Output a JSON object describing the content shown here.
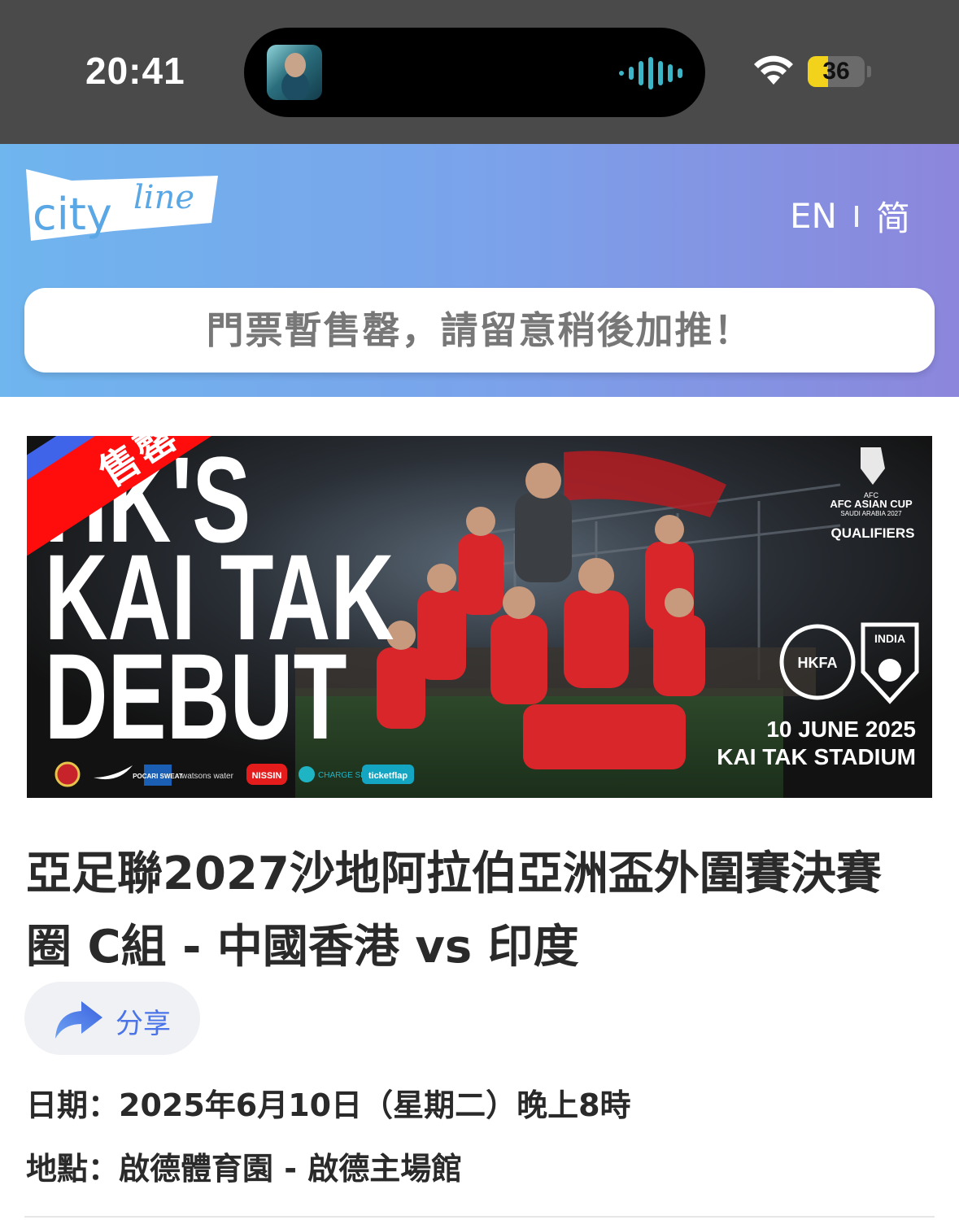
{
  "status_bar": {
    "time": "20:41",
    "battery_percent": "36",
    "battery_level": 0.36,
    "icons": [
      "now-playing-artwork",
      "audio-waveform-icon",
      "wifi-icon",
      "battery-icon"
    ]
  },
  "header": {
    "logo_text": "cityline",
    "lang_en": "EN",
    "lang_sc": "简",
    "notice": "門票暫售罄，請留意稍後加推！"
  },
  "banner": {
    "sold_out_label": "售罄",
    "headline_line1": "HK'S",
    "headline_line2": "KAI TAK",
    "headline_line3": "DEBUT",
    "competition": "AFC ASIAN CUP",
    "competition_sub": "SAUDI ARABIA 2027",
    "stage": "QUALIFIERS",
    "team_home_badge": "HKFA",
    "team_away_badge": "INDIA",
    "match_date": "10 JUNE 2025",
    "match_venue": "KAI TAK STADIUM",
    "sponsors": [
      "POCARI SWEAT",
      "watsons water",
      "NISSIN",
      "CHARGE SPOT",
      "ticketflap"
    ]
  },
  "event": {
    "title": "亞足聯2027沙地阿拉伯亞洲盃外圍賽決賽圈 C組 - 中國香港 vs 印度",
    "share_label": "分享",
    "date_line": "日期：2025年6月10日（星期二）晚上8時",
    "venue_line": "地點：啟德體育園 - 啟德主場館"
  },
  "colors": {
    "status_bar_bg": "#4a4a4a",
    "header_gradient_start": "#6fb5ee",
    "header_gradient_end": "#8c86dc",
    "sold_out_red": "#ff0d0d",
    "ribbon_blue": "#3f64ea",
    "share_blue": "#4a74e8"
  }
}
